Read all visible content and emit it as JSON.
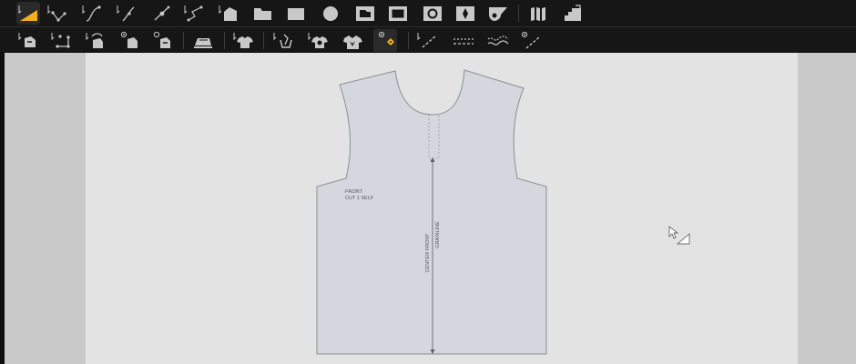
{
  "colors": {
    "accent": "#f2b01e",
    "icon": "#c8c8c8",
    "toolbar_bg": "#161616",
    "canvas": "#e3e3e3",
    "workspace": "#c9c9c9",
    "pattern_fill": "#d4d7de",
    "pattern_stroke": "#8a8e96"
  },
  "toolbar_row1": [
    "select-tool-icon",
    "add-point-icon",
    "curve-point-icon",
    "smooth-curve-icon",
    "point-on-line-icon",
    "polyline-icon",
    "add-piece-icon",
    "folder-shape-icon",
    "rectangle-fill-icon",
    "circle-fill-icon",
    "tab-shape-icon",
    "rectangle-outline-icon",
    "circle-outline-icon",
    "diamond-icon",
    "shield-shape-icon",
    "pleat-icon",
    "stair-step-icon"
  ],
  "toolbar_row2": [
    "piece-convert-icon",
    "piece-points-icon",
    "piece-rotate-icon",
    "piece-view-icon",
    "piece-measure-icon",
    "iron-icon",
    "garment-icon",
    "garment-sew-icon",
    "garment-trim-icon",
    "garment-check-icon",
    "show-notches-icon",
    "line-dashed-icon",
    "line-dotted-icon",
    "wave-line-icon",
    "line-visibility-icon"
  ],
  "pattern_piece": {
    "label_line1": "FRONT",
    "label_line2": "CUT 1 SELF",
    "grainline_line1": "CENTER FRONT",
    "grainline_line2": "GRAINLINE"
  },
  "cursor": "resize-cursor-icon"
}
